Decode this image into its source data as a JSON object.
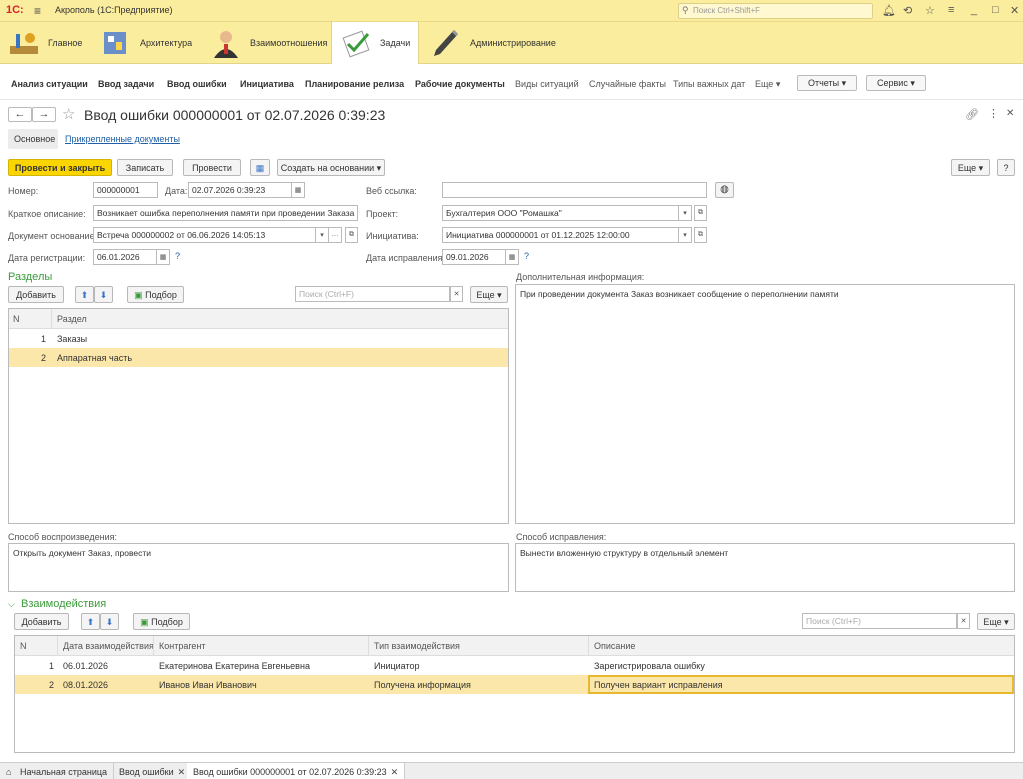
{
  "titlebar": {
    "logo": "1С:",
    "title": "Акрополь  (1С:Предприятие)",
    "search_placeholder": "Поиск Ctrl+Shift+F"
  },
  "sections": [
    {
      "label": "Главное"
    },
    {
      "label": "Архитектура"
    },
    {
      "label": "Взаимоотношения"
    },
    {
      "label": "Задачи"
    },
    {
      "label": "Администрирование"
    }
  ],
  "nav": {
    "items": [
      "Анализ ситуации",
      "Ввод задачи",
      "Ввод ошибки",
      "Инициатива",
      "Планирование релиза",
      "Рабочие документы"
    ],
    "light_items": [
      "Виды ситуаций",
      "Случайные факты",
      "Типы важных дат",
      "Еще"
    ],
    "reports": "Отчеты",
    "service": "Сервис"
  },
  "form": {
    "title": "Ввод ошибки 000000001 от 02.07.2026 0:39:23",
    "tab_main": "Основное",
    "tab_docs": "Прикрепленные документы",
    "btn_post_close": "Провести и закрыть",
    "btn_write": "Записать",
    "btn_post": "Провести",
    "btn_create_based": "Создать на основании",
    "btn_more": "Еще",
    "btn_help": "?",
    "fields": {
      "number_label": "Номер:",
      "number": "000000001",
      "date_label": "Дата:",
      "date": "02.07.2026  0:39:23",
      "short_desc_label": "Краткое описание:",
      "short_desc": "Возникает ошибка переполнения памяти при проведении Заказа",
      "base_doc_label": "Документ основание:",
      "base_doc": "Встреча 000000002 от 06.06.2026 14:05:13",
      "reg_date_label": "Дата регистрации:",
      "reg_date": "06.01.2026",
      "web_link_label": "Веб ссылка:",
      "web_link": "",
      "project_label": "Проект:",
      "project": "Бухгалтерия ООО \"Ромашка\"",
      "initiative_label": "Инициатива:",
      "initiative": "Инициатива 000000001 от 01.12.2025 12:00:00",
      "fix_date_label": "Дата исправления:",
      "fix_date": "09.01.2026"
    },
    "sections_group": {
      "title": "Разделы",
      "add": "Добавить",
      "pick": "Подбор",
      "search_placeholder": "Поиск (Ctrl+F)",
      "more": "Еще",
      "columns": [
        "N",
        "Раздел"
      ],
      "rows": [
        [
          "1",
          "Заказы"
        ],
        [
          "2",
          "Аппаратная часть"
        ]
      ]
    },
    "extra_info_label": "Дополнительная информация:",
    "extra_info": "При проведении документа Заказ возникает сообщение о переполнении памяти",
    "repro_label": "Способ воспроизведения:",
    "repro": "Открыть документ Заказ, провести",
    "fix_label": "Способ исправления:",
    "fix": "Вынести вложенную структуру в отдельный элемент",
    "interactions": {
      "title": "Взаимодействия",
      "add": "Добавить",
      "pick": "Подбор",
      "search_placeholder": "Поиск (Ctrl+F)",
      "more": "Еще",
      "columns": [
        "N",
        "Дата взаимодействия",
        "Контрагент",
        "Тип взаимодействия",
        "Описание"
      ],
      "rows": [
        [
          "1",
          "06.01.2026",
          "Екатеринова Екатерина Евгеньевна",
          "Инициатор",
          "Зарегистрировала ошибку"
        ],
        [
          "2",
          "08.01.2026",
          "Иванов Иван Иванович",
          "Получена информация",
          "Получен вариант исправления"
        ]
      ]
    }
  },
  "bottom_tabs": [
    "Начальная страница",
    "Ввод ошибки",
    "Ввод ошибки 000000001 от 02.07.2026 0:39:23"
  ]
}
